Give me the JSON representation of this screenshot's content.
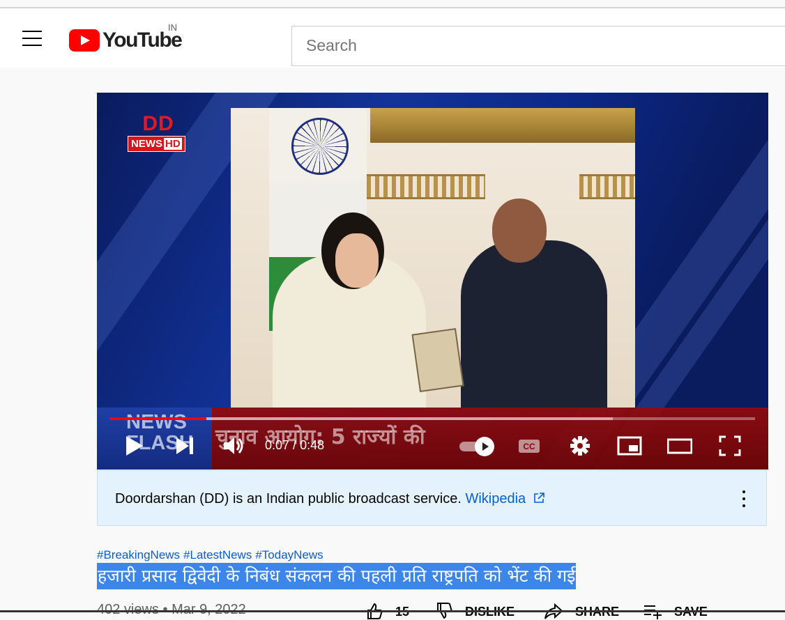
{
  "header": {
    "logo_text": "YouTube",
    "country": "IN",
    "search_placeholder": "Search"
  },
  "player": {
    "channel_logo_top": "DD",
    "channel_logo_news": "NEWS",
    "channel_logo_hd": "HD",
    "flash_line1": "NEWS",
    "flash_line2": "FLASH",
    "ticker": "चुनाव आयोग: 5 राज्यों की",
    "time_current": "0:07",
    "time_separator": " / ",
    "time_total": "0:48",
    "played_fraction": 0.15,
    "loaded_fraction": 0.78,
    "autoplay": true,
    "cc_label": "CC"
  },
  "info_panel": {
    "text": "Doordarshan (DD) is an Indian public broadcast service.",
    "link_label": "Wikipedia"
  },
  "video": {
    "hashtags": [
      "#BreakingNews",
      "#LatestNews",
      "#TodayNews"
    ],
    "title": "हजारी प्रसाद द्विवेदी के निबंध संकलन की पहली प्रति राष्ट्रपति को भेंट की गई",
    "views": "402 views",
    "separator": " • ",
    "date": "Mar 9, 2022",
    "like_count": "15",
    "dislike_label": "DISLIKE",
    "share_label": "SHARE",
    "save_label": "SAVE"
  },
  "colors": {
    "brand_red": "#ff0000",
    "link_blue": "#065fd4",
    "title_highlight": "#3b86e8",
    "info_bg": "#e3f2fd"
  }
}
